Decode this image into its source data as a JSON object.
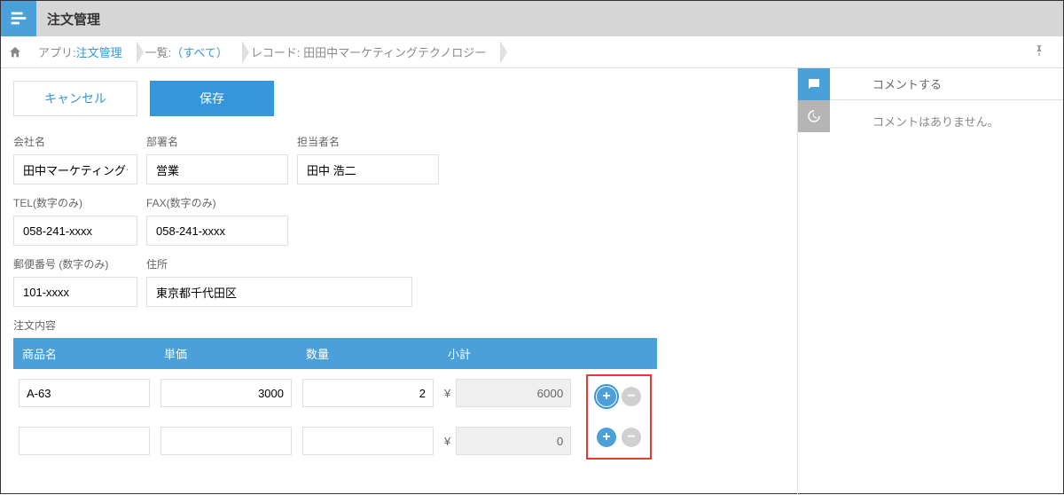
{
  "header": {
    "title": "注文管理"
  },
  "breadcrumb": {
    "app_label": "アプリ:",
    "app_link": "注文管理",
    "list_label": "一覧:",
    "list_link": "（すべて）",
    "record_label": "レコード: 田田中マーケティングテクノロジー"
  },
  "buttons": {
    "cancel": "キャンセル",
    "save": "保存"
  },
  "fields": {
    "company_label": "会社名",
    "company_value": "田中マーケティングテクノロジー",
    "dept_label": "部署名",
    "dept_value": "営業",
    "contact_label": "担当者名",
    "contact_value": "田中 浩二",
    "tel_label": "TEL(数字のみ)",
    "tel_value": "058-241-xxxx",
    "fax_label": "FAX(数字のみ)",
    "fax_value": "058-241-xxxx",
    "zip_label": "郵便番号 (数字のみ)",
    "zip_value": "101-xxxx",
    "addr_label": "住所",
    "addr_value": "東京都千代田区"
  },
  "order": {
    "title": "注文内容",
    "headers": {
      "name": "商品名",
      "price": "単価",
      "qty": "数量",
      "subtotal": "小計"
    },
    "yen": "¥",
    "rows": [
      {
        "name": "A-63",
        "price": "3000",
        "qty": "2",
        "subtotal": "6000"
      },
      {
        "name": "",
        "price": "",
        "qty": "",
        "subtotal": "0"
      }
    ]
  },
  "sidebar": {
    "comment_action": "コメントする",
    "empty": "コメントはありません。"
  }
}
